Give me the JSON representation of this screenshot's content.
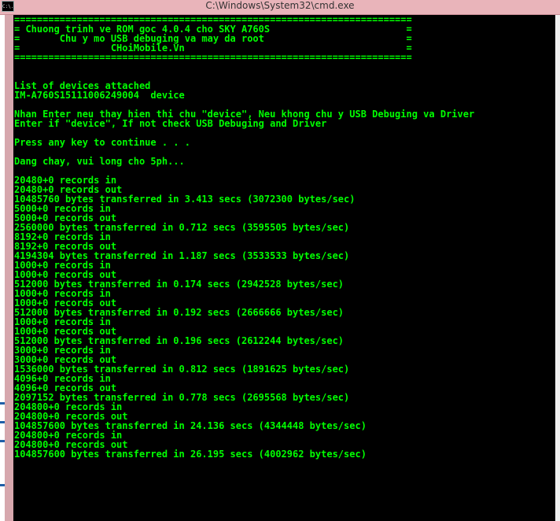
{
  "window": {
    "title": "C:\\Windows\\System32\\cmd.exe",
    "icon_label": "C:\\."
  },
  "console": {
    "lines": [
      "======================================================================",
      "= Chuong trinh ve ROM goc 4.0.4 cho SKY A760S                        =",
      "=       Chu y mo USB debuging va may da root                         =",
      "=                CHoiMobile.Vn                                       =",
      "======================================================================",
      "",
      "",
      "List of devices attached",
      "IM-A760S15111006249004  device",
      "",
      "Nhan Enter neu thay hien thi chu \"device\", Neu khong chu y USB Debuging va Driver",
      "Enter if \"device\", If not check USB Debuging and Driver",
      "",
      "Press any key to continue . . .",
      "",
      "Dang chay, vui long cho 5ph...",
      "",
      "20480+0 records in",
      "20480+0 records out",
      "10485760 bytes transferred in 3.413 secs (3072300 bytes/sec)",
      "5000+0 records in",
      "5000+0 records out",
      "2560000 bytes transferred in 0.712 secs (3595505 bytes/sec)",
      "8192+0 records in",
      "8192+0 records out",
      "4194304 bytes transferred in 1.187 secs (3533533 bytes/sec)",
      "1000+0 records in",
      "1000+0 records out",
      "512000 bytes transferred in 0.174 secs (2942528 bytes/sec)",
      "1000+0 records in",
      "1000+0 records out",
      "512000 bytes transferred in 0.192 secs (2666666 bytes/sec)",
      "1000+0 records in",
      "1000+0 records out",
      "512000 bytes transferred in 0.196 secs (2612244 bytes/sec)",
      "3000+0 records in",
      "3000+0 records out",
      "1536000 bytes transferred in 0.812 secs (1891625 bytes/sec)",
      "4096+0 records in",
      "4096+0 records out",
      "2097152 bytes transferred in 0.778 secs (2695568 bytes/sec)",
      "204800+0 records in",
      "204800+0 records out",
      "104857600 bytes transferred in 24.136 secs (4344448 bytes/sec)",
      "204800+0 records in",
      "204800+0 records out",
      "104857600 bytes transferred in 26.195 secs (4002962 bytes/sec)"
    ]
  },
  "colors": {
    "console_text": "#00ff00",
    "console_bg": "#000000",
    "titlebar": "#e9b4ba"
  }
}
